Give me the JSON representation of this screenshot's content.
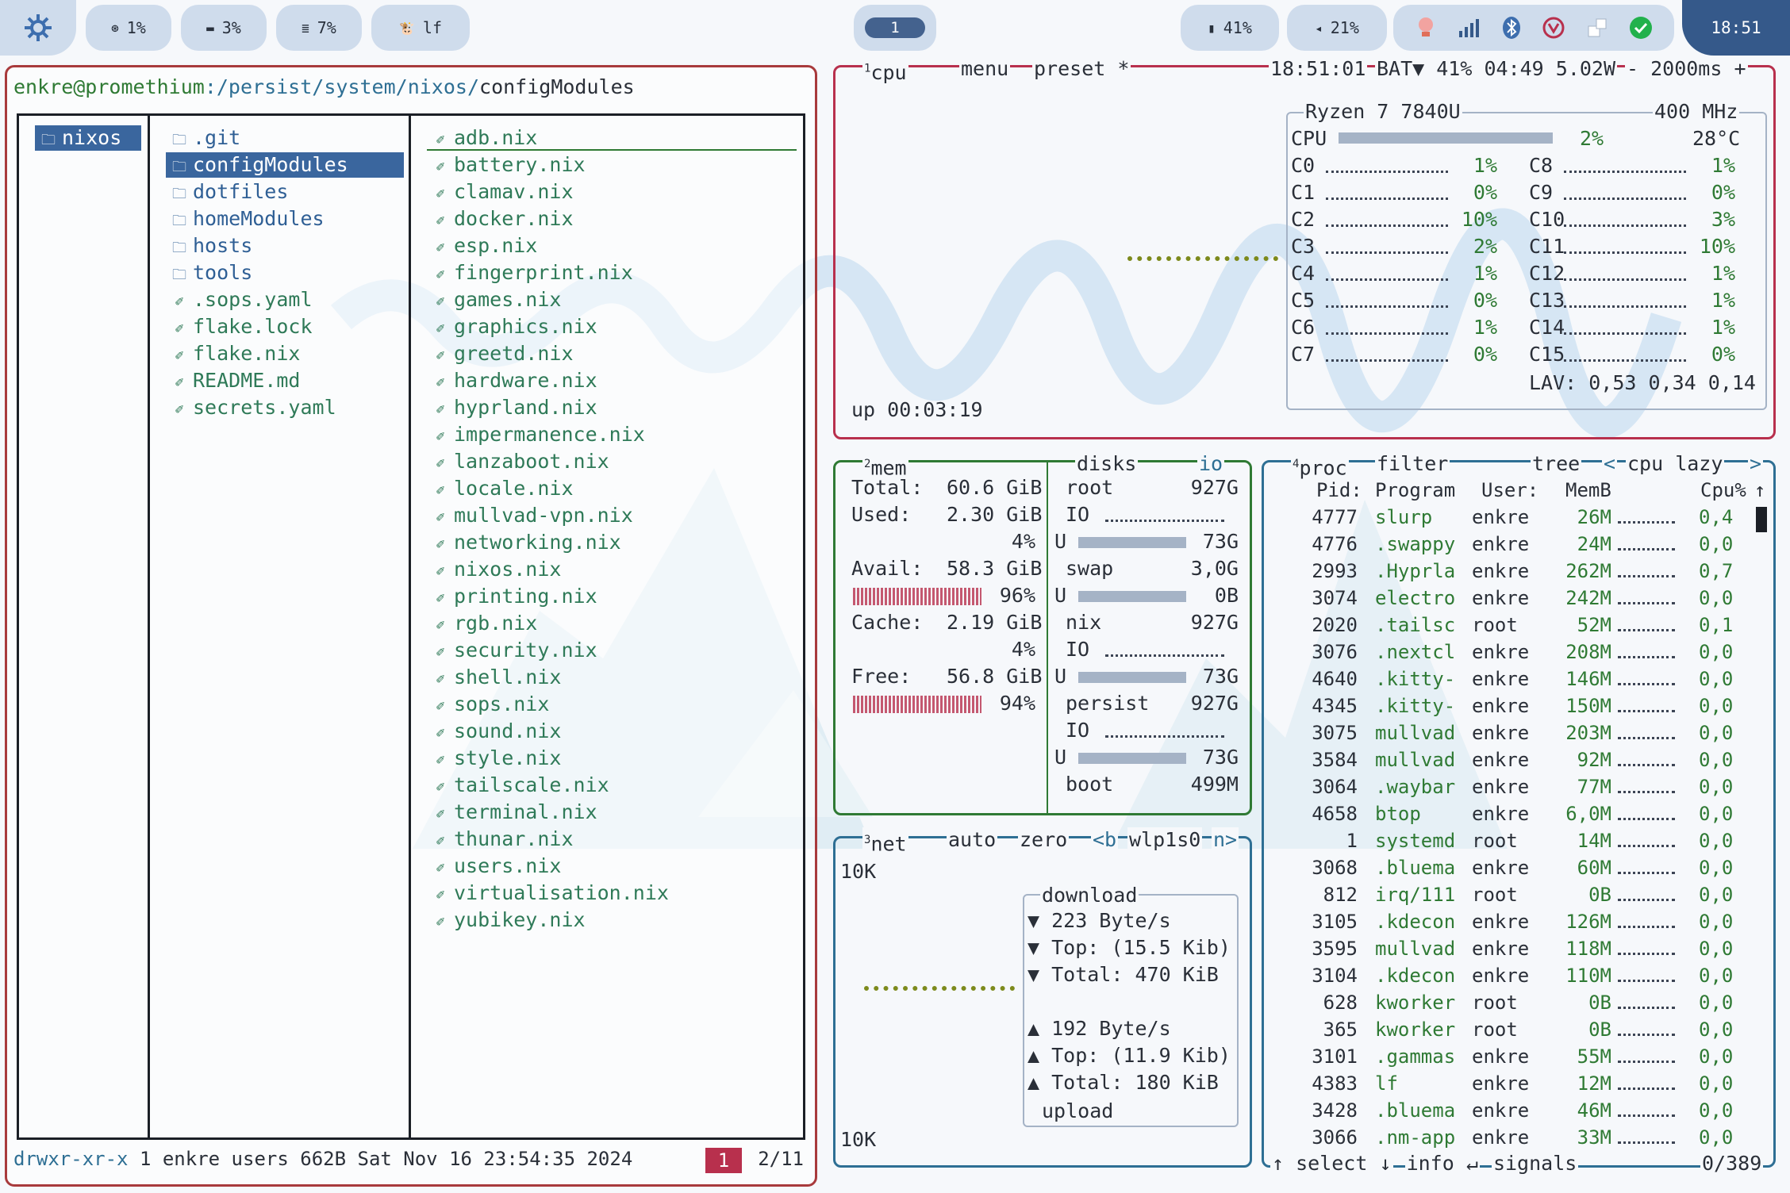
{
  "topbar": {
    "stats": [
      {
        "icon": "cpu-icon",
        "glyph": "⊛",
        "label": "1%"
      },
      {
        "icon": "memory-icon",
        "glyph": "▬",
        "label": "3%"
      },
      {
        "icon": "disk-icon",
        "glyph": "≣",
        "label": "7%"
      },
      {
        "icon": "cow-icon",
        "glyph": "🐮",
        "label": "lf"
      }
    ],
    "workspace": "1",
    "battery": "41%",
    "volume": "21%",
    "clock": "18:51"
  },
  "lf": {
    "path_user": "enkre@promethium",
    "path_dir": ":/persist/system/nixos/",
    "path_sel": "configModules",
    "parent": [
      "nixos"
    ],
    "current": [
      {
        "name": ".git",
        "type": "dir"
      },
      {
        "name": "configModules",
        "type": "dir",
        "selected": true
      },
      {
        "name": "dotfiles",
        "type": "dir"
      },
      {
        "name": "homeModules",
        "type": "dir"
      },
      {
        "name": "hosts",
        "type": "dir"
      },
      {
        "name": "tools",
        "type": "dir"
      },
      {
        "name": ".sops.yaml",
        "type": "file"
      },
      {
        "name": "flake.lock",
        "type": "file"
      },
      {
        "name": "flake.nix",
        "type": "file"
      },
      {
        "name": "README.md",
        "type": "file"
      },
      {
        "name": "secrets.yaml",
        "type": "file"
      }
    ],
    "preview": [
      "adb.nix",
      "battery.nix",
      "clamav.nix",
      "docker.nix",
      "esp.nix",
      "fingerprint.nix",
      "games.nix",
      "graphics.nix",
      "greetd.nix",
      "hardware.nix",
      "hyprland.nix",
      "impermanence.nix",
      "lanzaboot.nix",
      "locale.nix",
      "mullvad-vpn.nix",
      "networking.nix",
      "nixos.nix",
      "printing.nix",
      "rgb.nix",
      "security.nix",
      "shell.nix",
      "sops.nix",
      "sound.nix",
      "style.nix",
      "tailscale.nix",
      "terminal.nix",
      "thunar.nix",
      "users.nix",
      "virtualisation.nix",
      "yubikey.nix"
    ],
    "status_perm": "drwxr-xr-x",
    "status_info": "1 enkre users 662B Sat Nov 16 23:54:35 2024",
    "status_badge": "1",
    "status_pos": "2/11"
  },
  "cpu": {
    "num": "1",
    "title": "cpu",
    "menu": "menu",
    "preset": "preset *",
    "time": "18:51:01",
    "bat": "BAT▼ 41% 04:49 5.02W",
    "interval": "- 2000ms +",
    "model": "Ryzen 7 7840U",
    "freq": "400 MHz",
    "total_label": "CPU",
    "total_pct": "2%",
    "temp": "28°C",
    "cores_left": [
      [
        "C0",
        "1%"
      ],
      [
        "C1",
        "0%"
      ],
      [
        "C2",
        "10%"
      ],
      [
        "C3",
        "2%"
      ],
      [
        "C4",
        "1%"
      ],
      [
        "C5",
        "0%"
      ],
      [
        "C6",
        "1%"
      ],
      [
        "C7",
        "0%"
      ]
    ],
    "cores_right": [
      [
        "C8",
        "1%"
      ],
      [
        "C9",
        "0%"
      ],
      [
        "C10",
        "3%"
      ],
      [
        "C11",
        "10%"
      ],
      [
        "C12",
        "1%"
      ],
      [
        "C13",
        "1%"
      ],
      [
        "C14",
        "1%"
      ],
      [
        "C15",
        "0%"
      ]
    ],
    "lav": "LAV: 0,53 0,34 0,14",
    "uptime": "up 00:03:19"
  },
  "mem": {
    "num": "2",
    "title": "mem",
    "rows": [
      {
        "label": "Total:",
        "value": "60.6 GiB"
      },
      {
        "label": "Used:",
        "value": "2.30 GiB",
        "pct": "4%"
      },
      {
        "label": "Avail:",
        "value": "58.3 GiB",
        "pct": "96%"
      },
      {
        "label": "Cache:",
        "value": "2.19 GiB",
        "pct": "4%"
      },
      {
        "label": "Free:",
        "value": "56.8 GiB",
        "pct": "94%"
      }
    ]
  },
  "disks": {
    "title": "disks",
    "io": "io",
    "items": [
      {
        "name": "root",
        "size": "927G",
        "io": "IO",
        "used": "73G"
      },
      {
        "name": "swap",
        "size": "3,0G",
        "io": "",
        "used": "0B"
      },
      {
        "name": "nix",
        "size": "927G",
        "io": "IO",
        "used": "73G"
      },
      {
        "name": "persist",
        "size": "927G",
        "io": "IO",
        "used": "73G"
      },
      {
        "name": "boot",
        "size": "499M",
        "io": "",
        "used": ""
      }
    ],
    "u_label": "U"
  },
  "net": {
    "num": "3",
    "title": "net",
    "auto": "auto",
    "zero": "zero",
    "iface_prev": "<b",
    "iface": "wlp1s0",
    "iface_next": "n>",
    "scale_top": "10K",
    "scale_bottom": "10K",
    "download_label": "download",
    "download": [
      "▼ 223 Byte/s",
      "▼ Top: (15.5 Kib)",
      "▼ Total:  470 KiB"
    ],
    "upload": [
      "▲ 192 Byte/s",
      "▲ Top: (11.9 Kib)",
      "▲ Total:  180 KiB"
    ],
    "upload_label": "upload"
  },
  "proc": {
    "num": "4",
    "title": "proc",
    "filter": "filter",
    "tree": "tree",
    "sort_prev": "<",
    "sort": "cpu lazy",
    "sort_next": ">",
    "headers": [
      "Pid:",
      "Program",
      "User:",
      "MemB",
      "Cpu%"
    ],
    "rows": [
      [
        "4777",
        "slurp",
        "enkre",
        "26M",
        "0,4"
      ],
      [
        "4776",
        ".swappy",
        "enkre",
        "24M",
        "0,0"
      ],
      [
        "2993",
        ".Hyprla",
        "enkre",
        "262M",
        "0,7"
      ],
      [
        "3074",
        "electro",
        "enkre",
        "242M",
        "0,0"
      ],
      [
        "2020",
        ".tailsc",
        "root",
        "52M",
        "0,1"
      ],
      [
        "3076",
        ".nextcl",
        "enkre",
        "208M",
        "0,0"
      ],
      [
        "4640",
        ".kitty-",
        "enkre",
        "146M",
        "0,0"
      ],
      [
        "4345",
        ".kitty-",
        "enkre",
        "150M",
        "0,0"
      ],
      [
        "3075",
        "mullvad",
        "enkre",
        "203M",
        "0,0"
      ],
      [
        "3584",
        "mullvad",
        "enkre",
        "92M",
        "0,0"
      ],
      [
        "3064",
        ".waybar",
        "enkre",
        "77M",
        "0,0"
      ],
      [
        "4658",
        "btop",
        "enkre",
        "6,0M",
        "0,0"
      ],
      [
        "1",
        "systemd",
        "root",
        "14M",
        "0,0"
      ],
      [
        "3068",
        ".bluema",
        "enkre",
        "60M",
        "0,0"
      ],
      [
        "812",
        "irq/111",
        "root",
        "0B",
        "0,0"
      ],
      [
        "3105",
        ".kdecon",
        "enkre",
        "126M",
        "0,0"
      ],
      [
        "3595",
        "mullvad",
        "enkre",
        "118M",
        "0,0"
      ],
      [
        "3104",
        ".kdecon",
        "enkre",
        "110M",
        "0,0"
      ],
      [
        "628",
        "kworker",
        "root",
        "0B",
        "0,0"
      ],
      [
        "365",
        "kworker",
        "root",
        "0B",
        "0,0"
      ],
      [
        "3101",
        ".gammas",
        "enkre",
        "55M",
        "0,0"
      ],
      [
        "4383",
        "lf",
        "enkre",
        "12M",
        "0,0"
      ],
      [
        "3428",
        ".bluema",
        "enkre",
        "46M",
        "0,0"
      ],
      [
        "3066",
        ".nm-app",
        "enkre",
        "33M",
        "0,0"
      ]
    ],
    "footer_select": "↑ select ↓",
    "footer_info": "info ↵",
    "footer_signals": "signals",
    "count": "0/389"
  },
  "colors": {
    "accent": "#35598a",
    "cpu_border": "#b8304d",
    "mem_border": "#2f7a34",
    "net_border": "#2e6f94",
    "lf_border": "#a83a3c"
  }
}
